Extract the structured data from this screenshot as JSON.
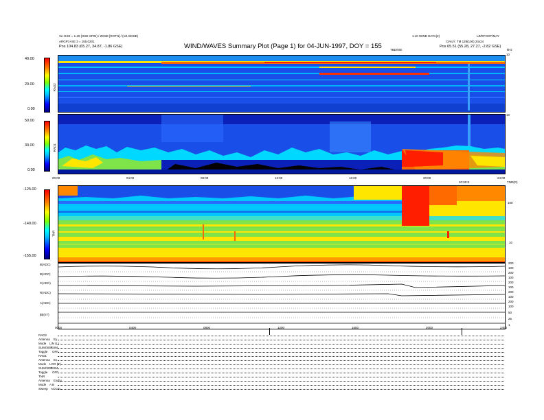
{
  "header": {
    "title": "WIND/WAVES Summary Plot (Page 1) for 04-JUN-1997, DOY = 155",
    "left_line1": "Xe-GSE = 1.20 (GSE SPIN) / ZGSE [ROTN] / (1/1 BGSE)",
    "left_line2": "ARGP1+SE 3 = 155.0201",
    "left_pos": "Pos    104.83 (65.27, 34.87, -1.86 GSE)",
    "right_line1": "LZ/RFOOT/MAY",
    "right_version": "1.10 WIND DATA(2)",
    "right_line2": "DAILY: TM 128(100) 24x24",
    "right_pos": "Pos    65.51 (55.28, 27.27, -2.82 GSE)",
    "tbd_label": "TBD/ISE",
    "khz_label": "kHz",
    "tnr_right_label": "TNR(R)"
  },
  "colors": {
    "background_blue": "#1a44e8",
    "deep_blue": "#0a10a8",
    "cyan": "#00d8ff",
    "green": "#7fe34a",
    "yellow": "#ffe600",
    "orange": "#ff8800",
    "red": "#ff1e00"
  },
  "chart_data": [
    {
      "type": "heatmap",
      "name": "RAD2",
      "ylabel": "RAD2",
      "colorbar_ticks": [
        "40.00",
        "20.00",
        "0.00"
      ],
      "right_ticks": [
        "10"
      ]
    },
    {
      "type": "heatmap",
      "name": "RAD1",
      "ylabel": "RAD1",
      "colorbar_ticks": [
        "50.00",
        "30.00",
        "0.00"
      ],
      "right_ticks": [
        "10"
      ]
    },
    {
      "type": "heatmap",
      "name": "TNR",
      "ylabel": "TNR",
      "colorbar_ticks": [
        "-125.00",
        "-140.00",
        "-155.00"
      ],
      "right_ticks": [
        "100",
        "10"
      ]
    },
    {
      "type": "line",
      "name": "housekeeping traces",
      "rows": [
        "B(ADC)",
        "B(ADC)",
        "C(ADC)",
        "R(ADC)",
        "A(ADC)",
        "|B|(nT)"
      ],
      "right_ticks": [
        "200",
        "100",
        "200",
        "100",
        "200",
        "100",
        "200",
        "100",
        "200",
        "100",
        "50",
        "25",
        "1"
      ]
    }
  ],
  "time_axis": {
    "top_ticks": [
      "00:00",
      "04:00",
      "08:00",
      "12:00",
      "16:00",
      "20:00",
      "24:00"
    ],
    "bottom_ticks": [
      "0000",
      "0400",
      "0800",
      "1200",
      "1600",
      "2000",
      "2400"
    ],
    "mark_20": "20:00:E"
  },
  "footer_rows": [
    {
      "label": "RAD2",
      "value": ""
    },
    {
      "label": "Antenna",
      "value": "Ey"
    },
    {
      "label": "Mode",
      "value": "LIN (L)"
    },
    {
      "label": "SUM/SEP",
      "value": "SUM"
    },
    {
      "label": "Toggle",
      "value": "OFF"
    },
    {
      "label": "RAD1",
      "value": ""
    },
    {
      "label": "Antenna",
      "value": "Ex"
    },
    {
      "label": "Mode",
      "value": "LOG (F)"
    },
    {
      "label": "SUM/SEP",
      "value": "SUM"
    },
    {
      "label": "Toggle",
      "value": "OFF"
    },
    {
      "label": "TNR",
      "value": ""
    },
    {
      "label": "Antenna",
      "value": "Ex/Ey"
    },
    {
      "label": "Mode",
      "value": "A B"
    },
    {
      "label": "Sweep",
      "value": "ACCEL"
    }
  ]
}
